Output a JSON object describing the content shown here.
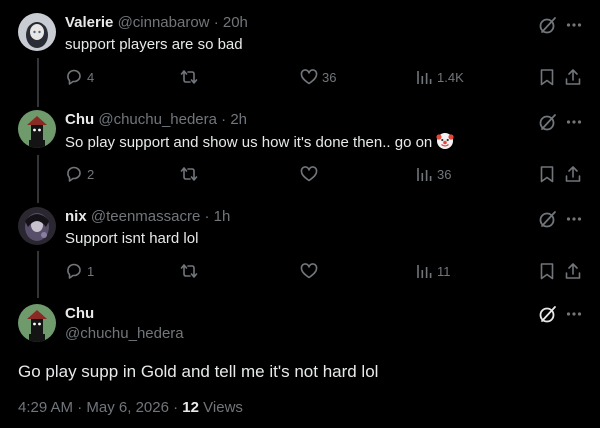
{
  "posts": [
    {
      "name": "Valerie",
      "handle": "@cinnabarow",
      "separator": "·",
      "time": "20h",
      "text": "support players are so bad",
      "replies": "4",
      "reposts": "",
      "likes": "36",
      "views": "1.4K"
    },
    {
      "name": "Chu",
      "handle": "@chuchu_hedera",
      "separator": "·",
      "time": "2h",
      "text": "So play support and show us how it's done then.. go on",
      "emoji": "clown-face",
      "replies": "2",
      "reposts": "",
      "likes": "",
      "views": "36"
    },
    {
      "name": "nix",
      "handle": "@teenmassacre",
      "separator": "·",
      "time": "1h",
      "text": "Support isnt hard lol",
      "replies": "1",
      "reposts": "",
      "likes": "",
      "views": "11"
    }
  ],
  "main_post": {
    "name": "Chu",
    "handle": "@chuchu_hedera",
    "text": "Go play supp in Gold and tell me it's not hard lol",
    "time": "4:29 AM",
    "separator": "·",
    "date": "May 6, 2026",
    "views_count": "12",
    "views_label": "Views"
  },
  "icons": [
    "reply-icon",
    "repost-icon",
    "like-icon",
    "views-icon",
    "bookmark-icon",
    "share-icon",
    "grok-icon",
    "more-icon"
  ],
  "colors": {
    "background": "#000000",
    "text": "#e7e9ea",
    "muted": "#71767b",
    "thread_line": "#333639"
  }
}
